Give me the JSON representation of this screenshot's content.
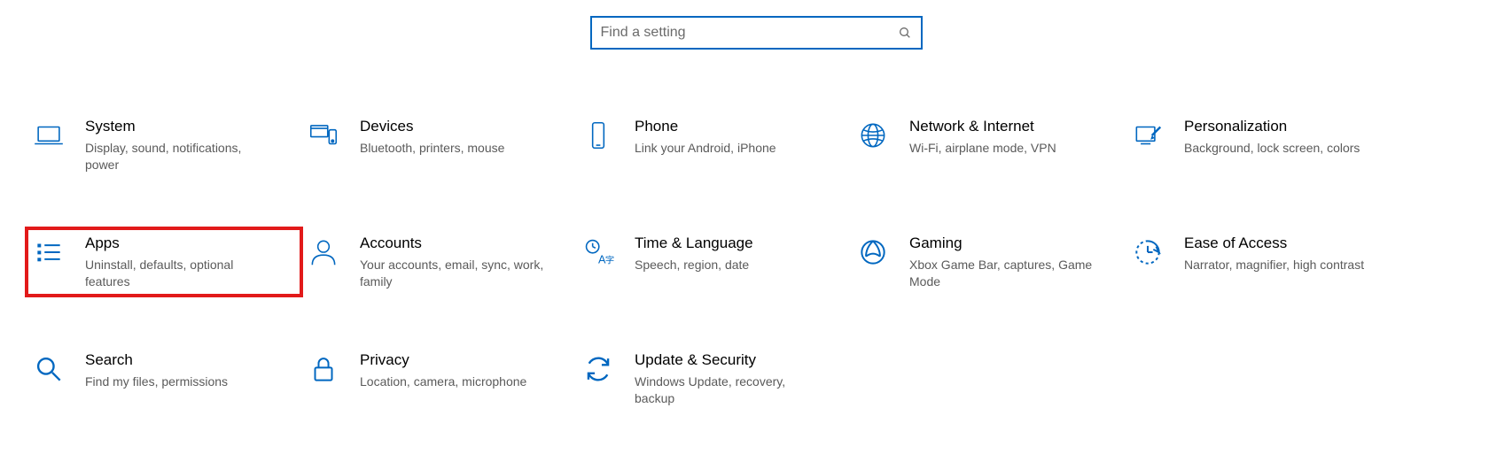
{
  "search": {
    "placeholder": "Find a setting"
  },
  "tiles": {
    "system": {
      "title": "System",
      "desc": "Display, sound, notifications, power"
    },
    "devices": {
      "title": "Devices",
      "desc": "Bluetooth, printers, mouse"
    },
    "phone": {
      "title": "Phone",
      "desc": "Link your Android, iPhone"
    },
    "network": {
      "title": "Network & Internet",
      "desc": "Wi-Fi, airplane mode, VPN"
    },
    "personalization": {
      "title": "Personalization",
      "desc": "Background, lock screen, colors"
    },
    "apps": {
      "title": "Apps",
      "desc": "Uninstall, defaults, optional features"
    },
    "accounts": {
      "title": "Accounts",
      "desc": "Your accounts, email, sync, work, family"
    },
    "time": {
      "title": "Time & Language",
      "desc": "Speech, region, date"
    },
    "gaming": {
      "title": "Gaming",
      "desc": "Xbox Game Bar, captures, Game Mode"
    },
    "ease": {
      "title": "Ease of Access",
      "desc": "Narrator, magnifier, high contrast"
    },
    "searchcat": {
      "title": "Search",
      "desc": "Find my files, permissions"
    },
    "privacy": {
      "title": "Privacy",
      "desc": "Location, camera, microphone"
    },
    "update": {
      "title": "Update & Security",
      "desc": "Windows Update, recovery, backup"
    }
  },
  "colors": {
    "accent": "#0067c0",
    "highlight": "#e21a1a"
  }
}
